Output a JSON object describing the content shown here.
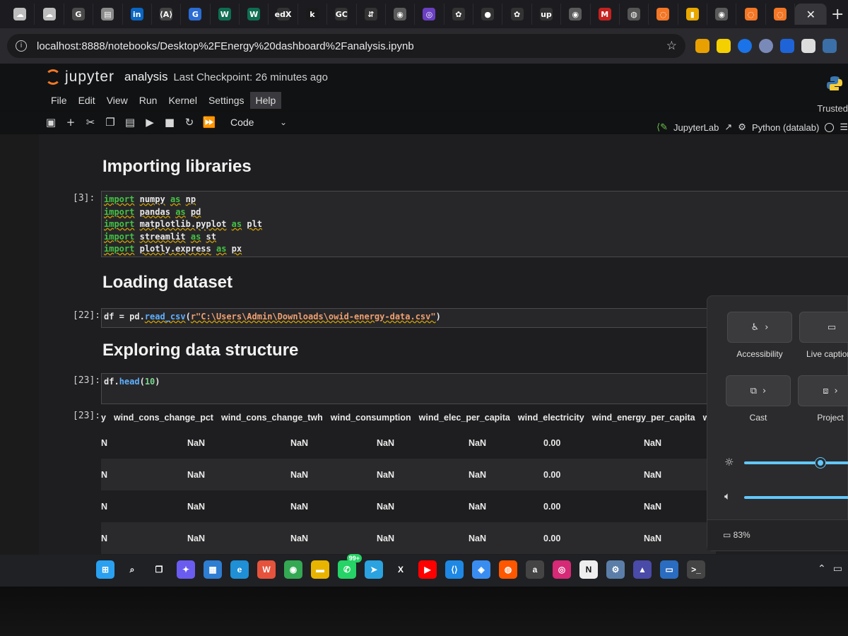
{
  "browser": {
    "tabs": [
      {
        "icon": "cloud-icon",
        "color": "#bdbdbd",
        "glyph": "☁"
      },
      {
        "icon": "cloud-icon",
        "color": "#bdbdbd",
        "glyph": "☁"
      },
      {
        "icon": "google-icon",
        "color": "#4a4a4a",
        "glyph": "G"
      },
      {
        "icon": "news-icon",
        "color": "#8a8a8a",
        "glyph": "▤"
      },
      {
        "icon": "linkedin-icon",
        "color": "#0a66c2",
        "glyph": "in"
      },
      {
        "icon": "cmd-icon",
        "color": "#444",
        "glyph": "⟨A⟩"
      },
      {
        "icon": "google-icon",
        "color": "#2b6cd4",
        "glyph": "G"
      },
      {
        "icon": "w-icon",
        "color": "#0f6e52",
        "glyph": "W"
      },
      {
        "icon": "w-icon",
        "color": "#0f6e52",
        "glyph": "W"
      },
      {
        "icon": "edx-icon",
        "color": "#333",
        "glyph": "edX"
      },
      {
        "icon": "k-icon",
        "color": "#1a1a1a",
        "glyph": "k"
      },
      {
        "icon": "gc-icon",
        "color": "#333",
        "glyph": "GC"
      },
      {
        "icon": "arrow-icon",
        "color": "#333",
        "glyph": "⇵"
      },
      {
        "icon": "globe-icon",
        "color": "#5a5a5a",
        "glyph": "◉"
      },
      {
        "icon": "circle-icon",
        "color": "#6a3fc2",
        "glyph": "◎"
      },
      {
        "icon": "openai-icon",
        "color": "#333",
        "glyph": "✿"
      },
      {
        "icon": "github-icon",
        "color": "#333",
        "glyph": "●"
      },
      {
        "icon": "openai-icon",
        "color": "#333",
        "glyph": "✿"
      },
      {
        "icon": "upwork-icon",
        "color": "#333",
        "glyph": "up"
      },
      {
        "icon": "globe-icon",
        "color": "#5a5a5a",
        "glyph": "◉"
      },
      {
        "icon": "gmail-icon",
        "color": "#c5221f",
        "glyph": "M"
      },
      {
        "icon": "jupyter-icon",
        "color": "#555",
        "glyph": "◍"
      },
      {
        "icon": "jupyter-icon",
        "color": "#f37726",
        "glyph": "◌"
      },
      {
        "icon": "note-icon",
        "color": "#e8a800",
        "glyph": "▮"
      },
      {
        "icon": "globe-icon",
        "color": "#5a5a5a",
        "glyph": "◉"
      },
      {
        "icon": "jupyter-icon",
        "color": "#f37726",
        "glyph": "◌"
      },
      {
        "icon": "jupyter-icon",
        "color": "#f37726",
        "glyph": "◌"
      }
    ],
    "active_tab_close": "✕",
    "url": "localhost:8888/notebooks/Desktop%2FEnergy%20dashboard%2Fanalysis.ipynb"
  },
  "jupyter": {
    "logo_text": "jupyter",
    "notebook_name": "analysis",
    "checkpoint": "Last Checkpoint: 26 minutes ago",
    "menu": [
      "File",
      "Edit",
      "View",
      "Run",
      "Kernel",
      "Settings",
      "Help"
    ],
    "trusted": "Trusted",
    "cell_type": "Code",
    "jupyterlab_link": "JupyterLab",
    "kernel": "Python (datalab)"
  },
  "cells": {
    "h_import": "Importing libraries",
    "prompt_import": "[3]:",
    "import_lines": [
      {
        "kw": "import",
        "mod": "numpy",
        "as": "as",
        "alias": "np"
      },
      {
        "kw": "import",
        "mod": "pandas",
        "as": "as",
        "alias": "pd"
      },
      {
        "kw": "import",
        "mod": "matplotlib.pyplot",
        "as": "as",
        "alias": "plt"
      },
      {
        "kw": "import",
        "mod": "streamlit",
        "as": "as",
        "alias": "st"
      },
      {
        "kw": "import",
        "mod": "plotly.express",
        "as": "as",
        "alias": "px"
      }
    ],
    "h_load": "Loading dataset",
    "prompt_load": "[22]:",
    "load_code": {
      "lhs": "df = pd.",
      "fn": "read_csv",
      "paren": "(",
      "str": "r\"C:\\Users\\Admin\\Downloads\\owid-energy-data.csv\"",
      "close": ")"
    },
    "h_explore": "Exploring data structure",
    "prompt_head": "[23]:",
    "head_code": {
      "lhs": "df.",
      "fn": "head",
      "open": "(",
      "num": "10",
      "close": ")"
    },
    "prompt_out": "[23]:",
    "columns": [
      "y",
      "wind_cons_change_pct",
      "wind_cons_change_twh",
      "wind_consumption",
      "wind_elec_per_capita",
      "wind_electricity",
      "wind_energy_per_capita",
      "wind_sh"
    ],
    "rows": [
      [
        "N",
        "NaN",
        "NaN",
        "NaN",
        "NaN",
        "0.00",
        "NaN"
      ],
      [
        "N",
        "NaN",
        "NaN",
        "NaN",
        "NaN",
        "0.00",
        "NaN"
      ],
      [
        "N",
        "NaN",
        "NaN",
        "NaN",
        "NaN",
        "0.00",
        "NaN"
      ],
      [
        "N",
        "NaN",
        "NaN",
        "NaN",
        "NaN",
        "0.00",
        "NaN"
      ]
    ]
  },
  "quick_settings": {
    "accessibility": "Accessibility",
    "live_captions": "Live caption",
    "cast": "Cast",
    "project": "Project",
    "brightness_level": 0.72,
    "volume_level": 1.0,
    "battery": "83%"
  },
  "taskbar": {
    "apps": [
      {
        "name": "windows-start-icon",
        "color": "#2aa0f0",
        "glyph": "⊞"
      },
      {
        "name": "search-icon",
        "color": "#202124",
        "glyph": "⌕"
      },
      {
        "name": "task-view-icon",
        "color": "#202124",
        "glyph": "❐"
      },
      {
        "name": "copilot-icon",
        "color": "#6b5cf0",
        "glyph": "✦"
      },
      {
        "name": "store-icon",
        "color": "#2d7dd2",
        "glyph": "▦"
      },
      {
        "name": "edge-icon",
        "color": "#1f8fd6",
        "glyph": "e"
      },
      {
        "name": "wps-icon",
        "color": "#e5533d",
        "glyph": "W"
      },
      {
        "name": "chrome-icon",
        "color": "#34a853",
        "glyph": "◉"
      },
      {
        "name": "folder-icon",
        "color": "#e8b400",
        "glyph": "▬"
      },
      {
        "name": "whatsapp-icon",
        "color": "#25d366",
        "glyph": "✆",
        "badge": "99+"
      },
      {
        "name": "telegram-icon",
        "color": "#2aa3e0",
        "glyph": "➤"
      },
      {
        "name": "x-icon",
        "color": "#202124",
        "glyph": "X"
      },
      {
        "name": "youtube-icon",
        "color": "#ff0000",
        "glyph": "▶"
      },
      {
        "name": "vscode-icon",
        "color": "#1e88e5",
        "glyph": "⟨⟩"
      },
      {
        "name": "app-icon",
        "color": "#3a8df0",
        "glyph": "◈"
      },
      {
        "name": "reddit-icon",
        "color": "#ff5700",
        "glyph": "◍"
      },
      {
        "name": "amazon-icon",
        "color": "#444",
        "glyph": "a"
      },
      {
        "name": "instagram-icon",
        "color": "#d62976",
        "glyph": "◎"
      },
      {
        "name": "notion-icon",
        "color": "#eee",
        "glyph": "N"
      },
      {
        "name": "settings-icon",
        "color": "#5a7ea8",
        "glyph": "⚙"
      },
      {
        "name": "app-icon",
        "color": "#4a4aa8",
        "glyph": "▲"
      },
      {
        "name": "monitor-icon",
        "color": "#2a6cc0",
        "glyph": "▭"
      },
      {
        "name": "terminal-icon",
        "color": "#444",
        "glyph": ">_"
      }
    ]
  }
}
